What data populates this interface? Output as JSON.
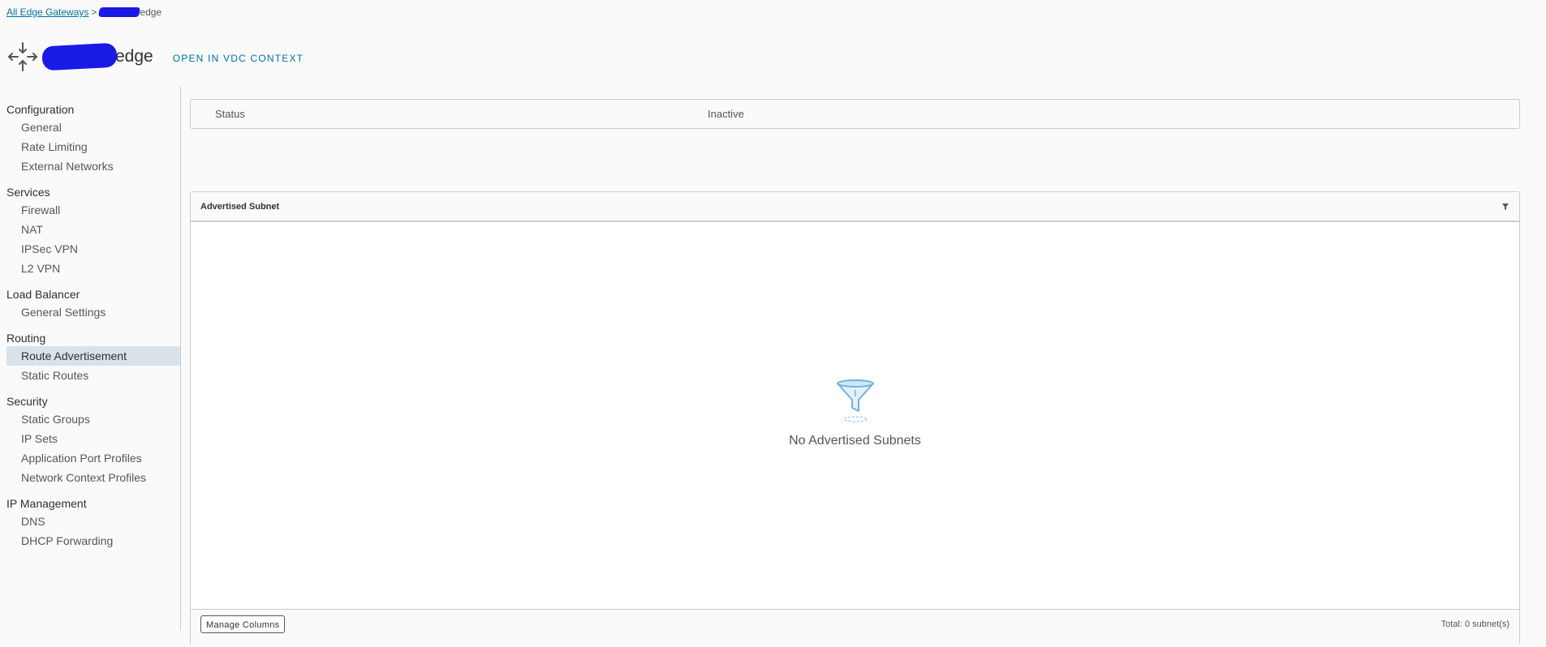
{
  "breadcrumb": {
    "parent_link": "All Edge Gateways",
    "separator": ">",
    "current_suffix": "edge"
  },
  "header": {
    "title_suffix": "edge",
    "vdc_link": "OPEN IN VDC CONTEXT",
    "icon": "edge-gateway-icon"
  },
  "sidebar": {
    "groups": [
      {
        "title": "Configuration",
        "items": [
          "General",
          "Rate Limiting",
          "External Networks"
        ]
      },
      {
        "title": "Services",
        "items": [
          "Firewall",
          "NAT",
          "IPSec VPN",
          "L2 VPN"
        ]
      },
      {
        "title": "Load Balancer",
        "items": [
          "General Settings"
        ]
      },
      {
        "title": "Routing",
        "items": [
          "Route Advertisement",
          "Static Routes"
        ]
      },
      {
        "title": "Security",
        "items": [
          "Static Groups",
          "IP Sets",
          "Application Port Profiles",
          "Network Context Profiles"
        ]
      },
      {
        "title": "IP Management",
        "items": [
          "DNS",
          "DHCP Forwarding"
        ]
      }
    ],
    "active_item": "Route Advertisement"
  },
  "status": {
    "label": "Status",
    "value": "Inactive"
  },
  "grid": {
    "column_header": "Advertised Subnet",
    "empty_text": "No Advertised Subnets",
    "manage_columns_label": "Manage Columns",
    "total_text": "Total: 0 subnet(s)"
  },
  "colors": {
    "link": "#0072a3",
    "active_bg": "#d8e3e9",
    "redaction": "#1a1ae6"
  }
}
